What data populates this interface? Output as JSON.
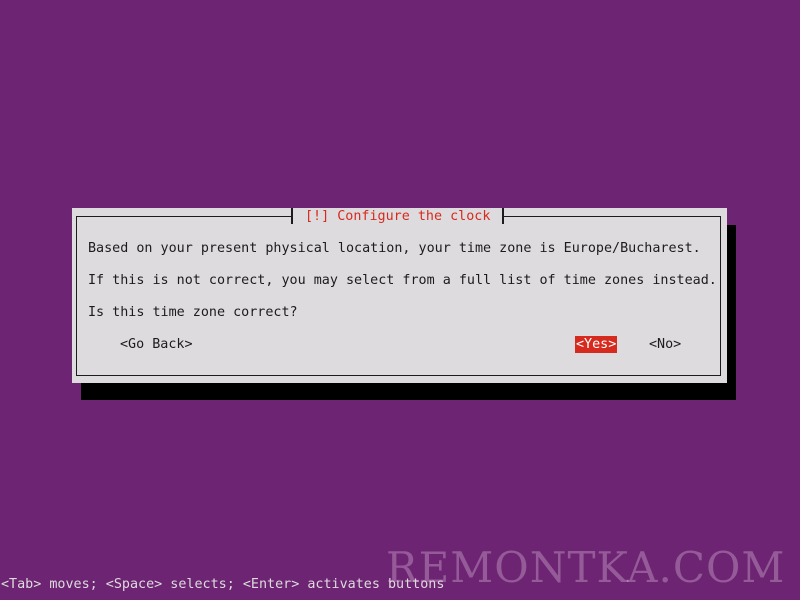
{
  "dialog": {
    "title": "[!] Configure the clock",
    "lines": [
      "Based on your present physical location, your time zone is Europe/Bucharest.",
      "If this is not correct, you may select from a full list of time zones instead.",
      "Is this time zone correct?"
    ],
    "buttons": {
      "back": "<Go Back>",
      "yes": "<Yes>",
      "no": "<No>"
    },
    "selected_button": "yes"
  },
  "status_bar": "<Tab> moves; <Space> selects; <Enter> activates buttons",
  "watermark": "REMONTKA.COM",
  "colors": {
    "background": "#6d2472",
    "dialog_bg": "#dedbde",
    "accent": "#d72a1e",
    "shadow": "#000000"
  }
}
